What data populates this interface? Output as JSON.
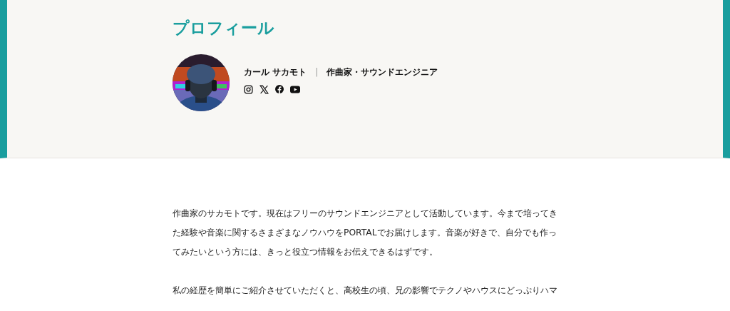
{
  "profile": {
    "heading": "プロフィール",
    "name": "カール サカモト",
    "separator": "|",
    "role": "作曲家・サウンドエンジニア",
    "social": [
      {
        "kind": "instagram"
      },
      {
        "kind": "x"
      },
      {
        "kind": "facebook"
      },
      {
        "kind": "youtube"
      }
    ]
  },
  "body": {
    "paragraphs": [
      "作曲家のサカモトです。現在はフリーのサウンドエンジニアとして活動しています。今まで培ってきた経験や音楽に関するさまざまなノウハウをPORTALでお届けします。音楽が好きで、自分でも作ってみたいという方には、きっと役立つ情報をお伝えできるはずです。",
      "私の経歴を簡単にご紹介させていただくと、高校生の頃、兄の影響でテクノやハウスにどっぷりハマ"
    ]
  }
}
